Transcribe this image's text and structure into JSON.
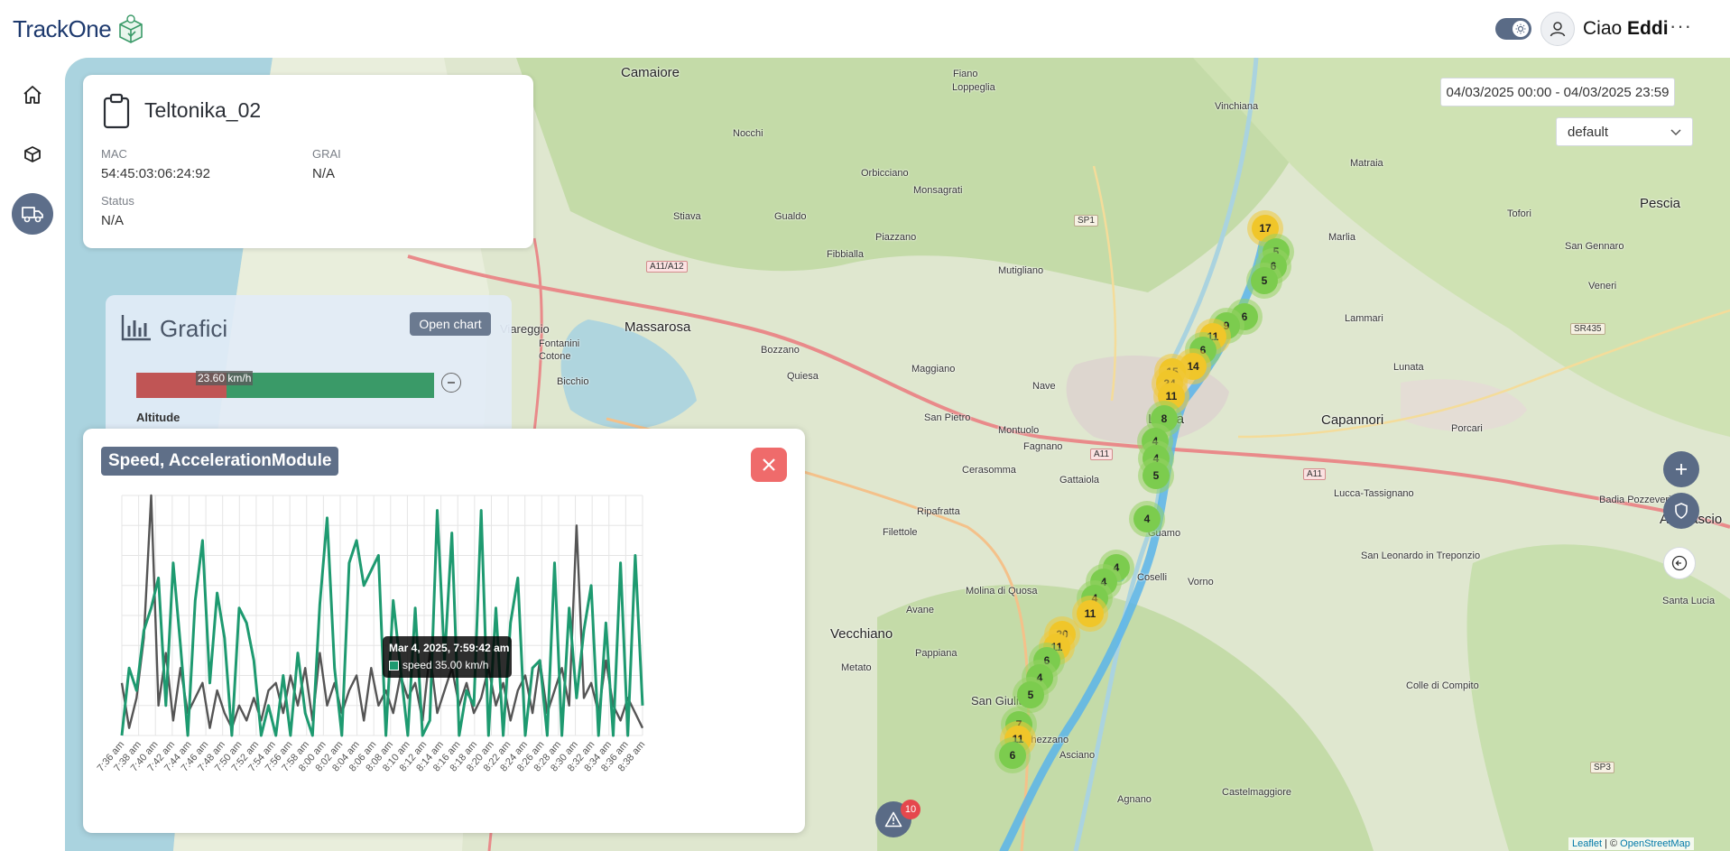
{
  "header": {
    "logo_text": "TrackOne",
    "greeting_prefix": "Ciao",
    "user_name": "Eddi",
    "more_label": "···"
  },
  "sidebar": {
    "items": [
      {
        "name": "home",
        "icon": "home-icon",
        "active": false
      },
      {
        "name": "packages",
        "icon": "box-icon",
        "active": false
      },
      {
        "name": "vehicles",
        "icon": "truck-icon",
        "active": true
      }
    ]
  },
  "device": {
    "name": "Teltonika_02",
    "mac_label": "MAC",
    "mac_value": "54:45:03:06:24:92",
    "grai_label": "GRAI",
    "grai_value": "N/A",
    "status_label": "Status",
    "status_value": "N/A"
  },
  "grafici": {
    "title": "Grafici",
    "open_chart_label": "Open chart",
    "speed_bar_label": "23.60 km/h",
    "altitude_label": "Altitude"
  },
  "map": {
    "date_range": "04/03/2025 00:00 - 04/03/2025 23:59",
    "profile_selected": "default",
    "attribution_leaflet": "Leaflet",
    "attribution_sep": " | © ",
    "attribution_osm": "OpenStreetMap",
    "alert_count": "10",
    "places": {
      "camaiore": "Camaiore",
      "lucca": "Lucca",
      "capannori": "Capannori",
      "massarosa": "Massarosa",
      "pescia": "Pescia",
      "altopascio": "Altopascio",
      "vecchiano": "Vecchiano",
      "viareggio": "Viareggio",
      "san_giuliano": "San Giuliano",
      "fiano": "Fiano",
      "loppeglia": "Loppeglia",
      "vinchiana": "Vinchiana",
      "guamo": "Guamo",
      "coselli": "Coselli",
      "marlia": "Marlia",
      "lunata": "Lunata",
      "porcari": "Porcari",
      "lucca_tassignano": "Lucca-Tassignano",
      "asciano": "Asciano",
      "agnano": "Agnano",
      "castelmaggiore": "Castelmaggiore",
      "santa_lucia": "Santa Lucia",
      "colle_di_compito": "Colle di Compito",
      "san_leonardo": "San Leonardo in Treponzio",
      "molina_di_quosa": "Molina di Quosa",
      "ripafratta": "Ripafratta",
      "filettole": "Filettole",
      "avane": "Avane",
      "cerasomma": "Cerasomma",
      "gattaiola": "Gattaiola",
      "fagnano": "Fagnano",
      "montuolo": "Montuolo",
      "quiesa": "Quiesa",
      "bozzano": "Bozzano",
      "maggiano": "Maggiano",
      "nave": "Nave",
      "gualdo": "Gualdo",
      "stiava": "Stiava",
      "piazzano": "Piazzano",
      "fibbialla": "Fibbialla",
      "mutigliano": "Mutigliano",
      "orbicciano": "Orbicciano",
      "monsagrati": "Monsagrati",
      "nocchi": "Nocchi",
      "matraia": "Matraia",
      "tofori": "Tofori",
      "veneri": "Veneri",
      "lammari": "Lammari",
      "bicchio": "Bicchio",
      "cotone": "Cotone",
      "fontanini": "Fontanini",
      "pappiana": "Pappiana",
      "metato": "Metato",
      "ghezzano": "Ghezzano",
      "vorno": "Vorno",
      "porcari_ponte": "Badia Pozzeveri",
      "san_pietro": "San Pietro",
      "san_gennaro": "San Gennaro"
    },
    "road_badges": [
      "SP1",
      "A11/A12",
      "A11",
      "A11",
      "SR435",
      "SP3"
    ],
    "clusters": [
      {
        "label": "17",
        "color": "yellow"
      },
      {
        "label": "5",
        "color": "green"
      },
      {
        "label": "6",
        "color": "green"
      },
      {
        "label": "5",
        "color": "green"
      },
      {
        "label": "6",
        "color": "green"
      },
      {
        "label": "9",
        "color": "green"
      },
      {
        "label": "11",
        "color": "yellow"
      },
      {
        "label": "6",
        "color": "green"
      },
      {
        "label": "14",
        "color": "yellow"
      },
      {
        "label": "15",
        "color": "yellow"
      },
      {
        "label": "24",
        "color": "yellow"
      },
      {
        "label": "11",
        "color": "yellow"
      },
      {
        "label": "8",
        "color": "green"
      },
      {
        "label": "4",
        "color": "green"
      },
      {
        "label": "4",
        "color": "green"
      },
      {
        "label": "5",
        "color": "green"
      },
      {
        "label": "4",
        "color": "green"
      },
      {
        "label": "4",
        "color": "green"
      },
      {
        "label": "4",
        "color": "green"
      },
      {
        "label": "4",
        "color": "green"
      },
      {
        "label": "11",
        "color": "yellow"
      },
      {
        "label": "20",
        "color": "yellow"
      },
      {
        "label": "11",
        "color": "yellow"
      },
      {
        "label": "6",
        "color": "green"
      },
      {
        "label": "4",
        "color": "green"
      },
      {
        "label": "5",
        "color": "green"
      },
      {
        "label": "7",
        "color": "green"
      },
      {
        "label": "11",
        "color": "yellow"
      },
      {
        "label": "6",
        "color": "green"
      }
    ]
  },
  "chart_panel": {
    "title": "Speed, AccelerationModule",
    "tooltip_title": "Mar 4, 2025, 7:59:42 am",
    "tooltip_value": "speed 35.00 km/h"
  },
  "chart_data": {
    "type": "line",
    "title": "Speed, AccelerationModule",
    "x_ticks": [
      "7:36 am",
      "7:38 am",
      "7:40 am",
      "7:42 am",
      "7:44 am",
      "7:46 am",
      "7:48 am",
      "7:50 am",
      "7:52 am",
      "7:54 am",
      "7:56 am",
      "7:58 am",
      "8:00 am",
      "8:02 am",
      "8:04 am",
      "8:06 am",
      "8:08 am",
      "8:10 am",
      "8:12 am",
      "8:14 am",
      "8:16 am",
      "8:18 am",
      "8:20 am",
      "8:22 am",
      "8:24 am",
      "8:26 am",
      "8:28 am",
      "8:30 am",
      "8:32 am",
      "8:34 am",
      "8:36 am",
      "8:38 am"
    ],
    "grid": true,
    "colors": {
      "speed": "#1e9a70",
      "accel": "#555555"
    },
    "series": [
      {
        "name": "speed",
        "color": "#1e9a70",
        "values": [
          0,
          18,
          12,
          28,
          34,
          42,
          8,
          46,
          24,
          0,
          36,
          52,
          14,
          38,
          26,
          0,
          34,
          30,
          20,
          0,
          8,
          0,
          16,
          0,
          22,
          6,
          0,
          35,
          58,
          18,
          0,
          46,
          52,
          40,
          44,
          48,
          0,
          36,
          18,
          0,
          34,
          0,
          4,
          60,
          20,
          54,
          0,
          12,
          8,
          60,
          0,
          34,
          0,
          30,
          42,
          0,
          18,
          20,
          0,
          46,
          0,
          34,
          10,
          28,
          40,
          0,
          30,
          0,
          46,
          0,
          48,
          8
        ]
      },
      {
        "name": "AccelerationModule",
        "color": "#555555",
        "values": [
          14,
          2,
          10,
          26,
          64,
          8,
          22,
          4,
          18,
          6,
          10,
          14,
          2,
          12,
          6,
          2,
          8,
          4,
          10,
          4,
          12,
          14,
          6,
          16,
          8,
          18,
          4,
          22,
          8,
          14,
          6,
          12,
          16,
          4,
          18,
          8,
          12,
          6,
          16,
          10,
          14,
          4,
          22,
          6,
          12,
          18,
          8,
          14,
          6,
          10,
          18,
          8,
          14,
          4,
          12,
          16,
          6,
          20,
          6,
          12,
          18,
          8,
          56,
          10,
          14,
          6,
          20,
          8,
          4,
          10,
          6,
          2
        ]
      }
    ],
    "ylim": [
      0,
      64
    ]
  }
}
